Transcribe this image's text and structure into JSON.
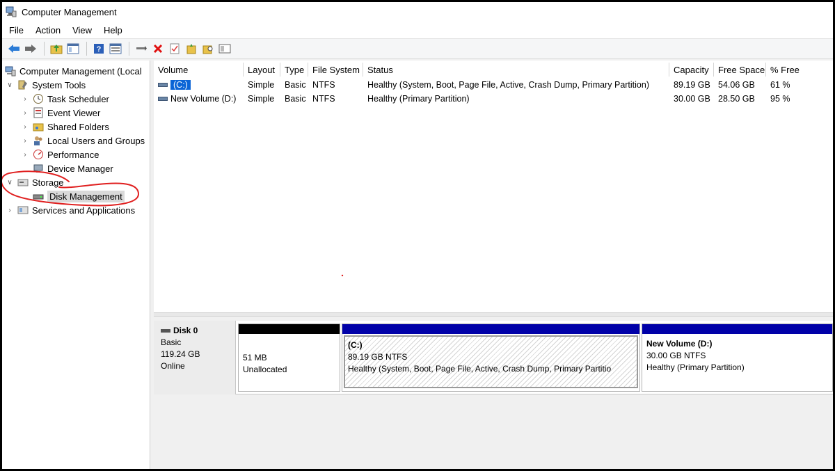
{
  "window": {
    "title": "Computer Management"
  },
  "menu": [
    "File",
    "Action",
    "View",
    "Help"
  ],
  "toolbar": [
    "back-arrow-icon",
    "forward-arrow-icon",
    "up-folder-icon",
    "show-hide-tree-icon",
    "help-icon",
    "properties-icon",
    "connect-icon",
    "delete-icon",
    "check-icon",
    "new-folder-icon",
    "search-folder-icon",
    "view-icon"
  ],
  "tree": {
    "root": "Computer Management (Local",
    "system_tools": "System Tools",
    "task_scheduler": "Task Scheduler",
    "event_viewer": "Event Viewer",
    "shared_folders": "Shared Folders",
    "local_users": "Local Users and Groups",
    "performance": "Performance",
    "device_manager": "Device Manager",
    "storage": "Storage",
    "disk_management": "Disk Management",
    "services": "Services and Applications"
  },
  "list": {
    "columns": [
      "Volume",
      "Layout",
      "Type",
      "File System",
      "Status",
      "Capacity",
      "Free Space",
      "% Free"
    ],
    "rows": [
      [
        "(C:)",
        "Simple",
        "Basic",
        "NTFS",
        "Healthy (System, Boot, Page File, Active, Crash Dump, Primary Partition)",
        "89.19 GB",
        "54.06 GB",
        "61 %"
      ],
      [
        "New Volume (D:)",
        "Simple",
        "Basic",
        "NTFS",
        "Healthy (Primary Partition)",
        "30.00 GB",
        "28.50 GB",
        "95 %"
      ]
    ]
  },
  "disk": {
    "name": "Disk 0",
    "type": "Basic",
    "size": "119.24 GB",
    "state": "Online",
    "partitions": [
      {
        "name": "",
        "size": "51 MB",
        "status": "Unallocated"
      },
      {
        "name": "(C:)",
        "size": "89.19 GB NTFS",
        "status": "Healthy (System, Boot, Page File, Active, Crash Dump, Primary Partitio"
      },
      {
        "name": "New Volume  (D:)",
        "size": "30.00 GB NTFS",
        "status": "Healthy (Primary Partition)"
      }
    ]
  },
  "colors": {
    "primary_bar": "#0000a8",
    "unallocated_bar": "#000000",
    "selection": "#0a64d6",
    "annotation": "#e02020"
  }
}
